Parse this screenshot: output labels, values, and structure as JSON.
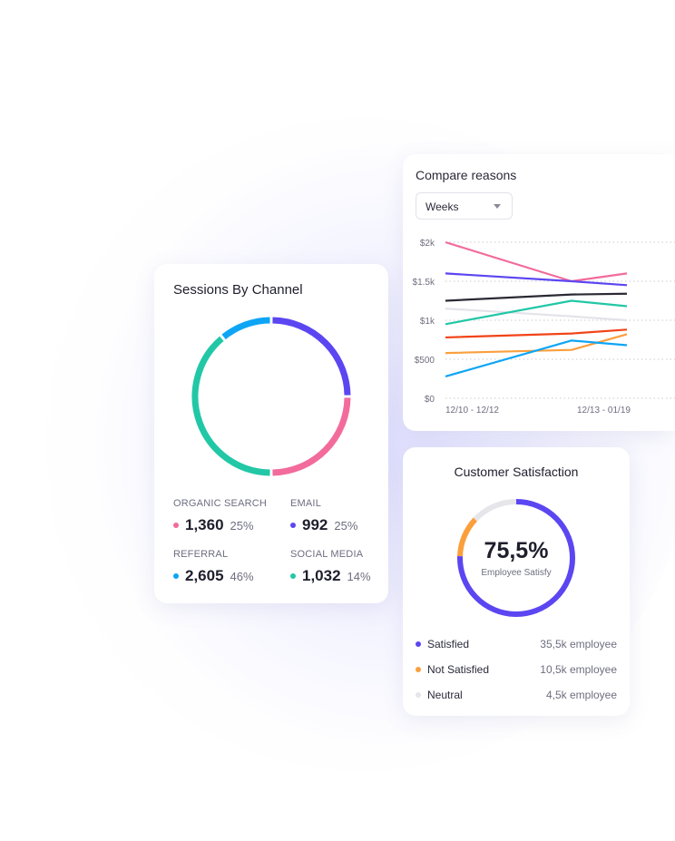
{
  "sessions": {
    "title": "Sessions By Channel",
    "items": [
      {
        "label": "ORGANIC SEARCH",
        "value": "1,360",
        "pct": "25%",
        "color": "#f26b9c"
      },
      {
        "label": "EMAIL",
        "value": "992",
        "pct": "25%",
        "color": "#5b46f1"
      },
      {
        "label": "REFERRAL",
        "value": "2,605",
        "pct": "46%",
        "color": "#0ea5f5"
      },
      {
        "label": "SOCIAL MEDIA",
        "value": "1,032",
        "pct": "14%",
        "color": "#22c7a6"
      }
    ]
  },
  "compare": {
    "title": "Compare reasons",
    "select_value": "Weeks",
    "select_icon": "chevron-down-icon"
  },
  "satisfaction": {
    "title": "Customer Satisfaction",
    "percent": "75,5%",
    "subtitle": "Employee Satisfy",
    "rows": [
      {
        "label": "Satisfied",
        "count": "35,5k employee",
        "color": "#5b46f1"
      },
      {
        "label": "Not Satisfied",
        "count": "10,5k employee",
        "color": "#fb9f3c"
      },
      {
        "label": "Neutral",
        "count": "4,5k employee",
        "color": "#e6e6ea"
      }
    ]
  },
  "chart_data": [
    {
      "type": "pie",
      "title": "Sessions By Channel",
      "categories": [
        "ORGANIC SEARCH",
        "EMAIL",
        "REFERRAL",
        "SOCIAL MEDIA"
      ],
      "values": [
        1360,
        992,
        2605,
        1032
      ],
      "display_order": [
        "EMAIL",
        "ORGANIC SEARCH",
        "SOCIAL MEDIA",
        "REFERRAL"
      ],
      "display_fractions": [
        0.25,
        0.25,
        0.39,
        0.11
      ],
      "colors": {
        "EMAIL": "#5b46f1",
        "ORGANIC SEARCH": "#f26b9c",
        "SOCIAL MEDIA": "#22c7a6",
        "REFERRAL": "#0ea5f5"
      },
      "style": "donut"
    },
    {
      "type": "line",
      "title": "Compare reasons",
      "x": [
        "12/10 - 12/12",
        "12/13 - 01/19",
        ""
      ],
      "x_tick_labels": [
        "12/10 - 12/12",
        "12/13 - 01/19"
      ],
      "y_ticks": [
        "$0",
        "$500",
        "$1k",
        "$1.5k",
        "$2k"
      ],
      "ylim": [
        0,
        2000
      ],
      "grid": true,
      "series": [
        {
          "color": "#f26b9c",
          "values": [
            2000,
            1500,
            1600
          ]
        },
        {
          "color": "#5b46f1",
          "values": [
            1600,
            1500,
            1450
          ]
        },
        {
          "color": "#2a2a35",
          "values": [
            1250,
            1330,
            1340
          ]
        },
        {
          "color": "#e3e3ea",
          "values": [
            1150,
            1050,
            1000
          ]
        },
        {
          "color": "#22c7a6",
          "values": [
            950,
            1250,
            1180
          ]
        },
        {
          "color": "#f24318",
          "values": [
            780,
            830,
            880
          ]
        },
        {
          "color": "#fb9f3c",
          "values": [
            580,
            620,
            820
          ]
        },
        {
          "color": "#0ea5f5",
          "values": [
            280,
            740,
            680
          ]
        }
      ]
    },
    {
      "type": "pie",
      "title": "Customer Satisfaction",
      "categories": [
        "Satisfied",
        "Not Satisfied",
        "Neutral"
      ],
      "values": [
        35.5,
        10.5,
        4.5
      ],
      "display_fractions": [
        0.755,
        0.115,
        0.13
      ],
      "colors": {
        "Satisfied": "#5b46f1",
        "Not Satisfied": "#fb9f3c",
        "Neutral": "#e6e6ea"
      },
      "style": "ring"
    }
  ]
}
